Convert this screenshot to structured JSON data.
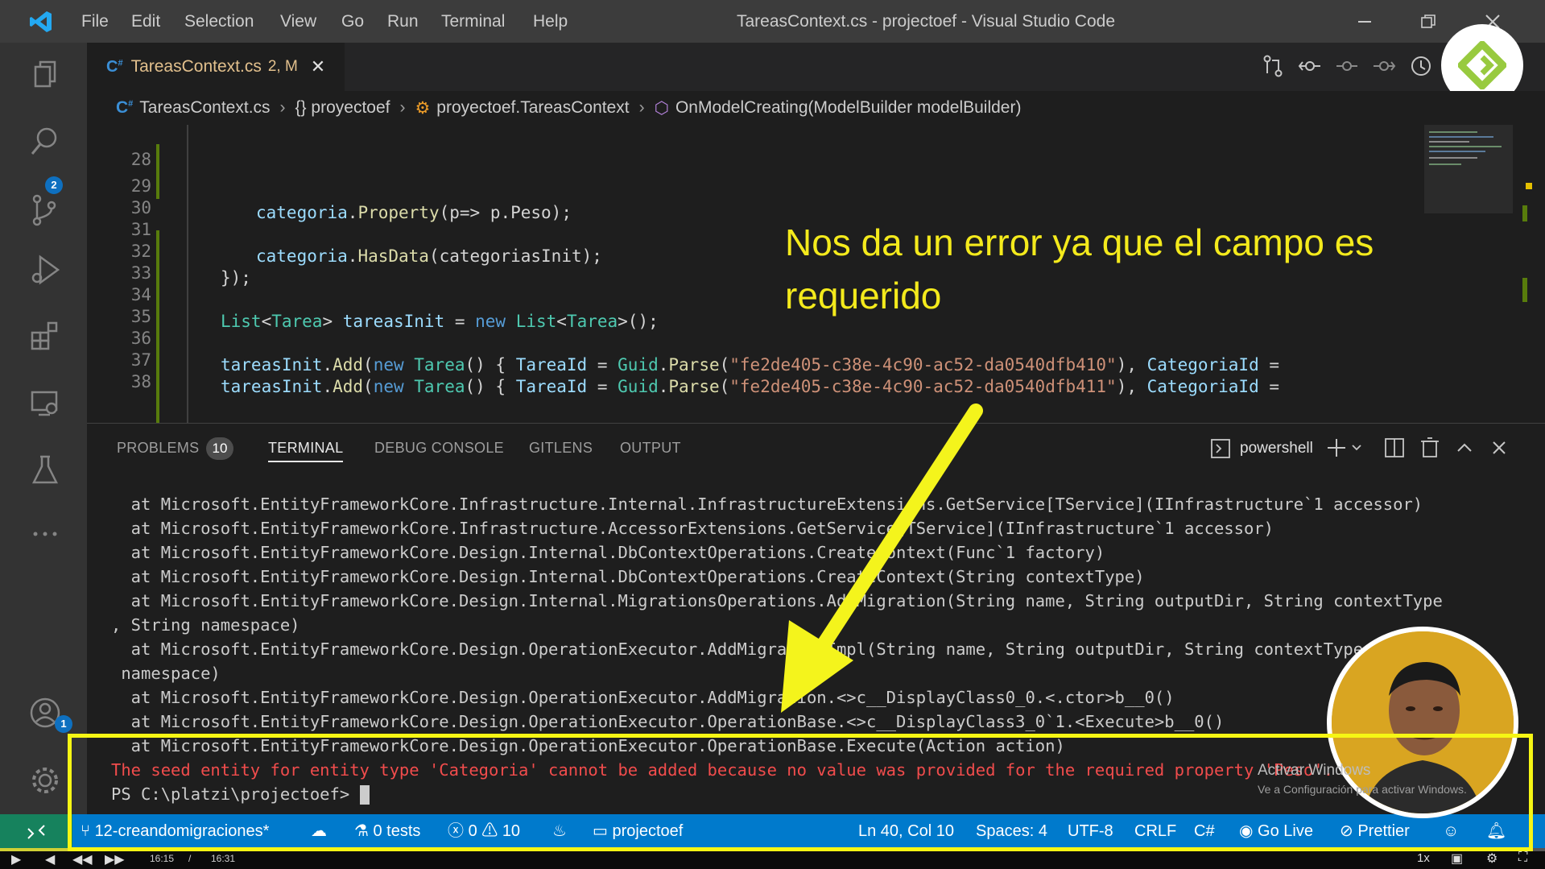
{
  "window": {
    "title": "TareasContext.cs - projectoef - Visual Studio Code",
    "menu": [
      "File",
      "Edit",
      "Selection",
      "View",
      "Go",
      "Run",
      "Terminal",
      "Help"
    ]
  },
  "activity_bar": {
    "source_control_badge": "2",
    "accounts_badge": "1",
    "icons": [
      "explorer-icon",
      "search-icon",
      "source-control-icon",
      "run-debug-icon",
      "extensions-icon",
      "remote-explorer-icon",
      "testing-icon",
      "more-icon",
      "accounts-icon",
      "manage-gear-icon"
    ]
  },
  "tab": {
    "label": "TareasContext.cs",
    "status": "2, M",
    "close": "✕"
  },
  "breadcrumb": {
    "file": "TareasContext.cs",
    "namespace": "{} proyectoef",
    "class": "proyectoef.TareasContext",
    "method": "OnModelCreating(ModelBuilder modelBuilder)"
  },
  "editor": {
    "line_numbers": [
      "28",
      "29",
      "30",
      "31",
      "32",
      "33",
      "34",
      "35",
      "36",
      "37",
      "38"
    ],
    "line29": {
      "obj": "categoria",
      "dot": ".",
      "fn": "Property",
      "args": "(p=> p.Peso);"
    },
    "line31": {
      "obj": "categoria",
      "dot": ".",
      "fn": "HasData",
      "args": "(categoriasInit);"
    },
    "line32": "});",
    "line34": {
      "t1": "List",
      "lt": "<",
      "t2": "Tarea",
      "gt": ">",
      "var": " tareasInit",
      "eq": " = ",
      "kw": "new",
      "t3": " List",
      "lt2": "<",
      "t4": "Tarea",
      "end": ">();"
    },
    "line36": {
      "var": "tareasInit",
      "dot": ".",
      "fn": "Add",
      "p1": "(",
      "kw": "new",
      "t": " Tarea",
      "p2": "() { ",
      "prop": "TareaId",
      "eq": " = ",
      "cls": "Guid",
      "dot2": ".",
      "fn2": "Parse",
      "p3": "(",
      "str": "\"fe2de405-c38e-4c90-ac52-da0540dfb410\"",
      "p4": "), ",
      "prop2": "CategoriaId",
      "eq2": " ="
    },
    "line37": {
      "var": "tareasInit",
      "dot": ".",
      "fn": "Add",
      "p1": "(",
      "kw": "new",
      "t": " Tarea",
      "p2": "() { ",
      "prop": "TareaId",
      "eq": " = ",
      "cls": "Guid",
      "dot2": ".",
      "fn2": "Parse",
      "p3": "(",
      "str": "\"fe2de405-c38e-4c90-ac52-da0540dfb411\"",
      "p4": "), ",
      "prop2": "CategoriaId",
      "eq2": " ="
    }
  },
  "annotation": {
    "line1": "Nos da un error ya que el campo es",
    "line2": "requerido"
  },
  "panel": {
    "tabs": {
      "problems": "PROBLEMS",
      "problems_count": "10",
      "terminal": "TERMINAL",
      "debug_console": "DEBUG CONSOLE",
      "gitlens": "GITLENS",
      "output": "OUTPUT"
    },
    "shell": "powershell"
  },
  "terminal": {
    "lines": [
      "  at Microsoft.EntityFrameworkCore.Infrastructure.Internal.InfrastructureExtensions.GetService[TService](IInfrastructure`1 accessor)",
      "  at Microsoft.EntityFrameworkCore.Infrastructure.AccessorExtensions.GetService[TService](IInfrastructure`1 accessor)",
      "  at Microsoft.EntityFrameworkCore.Design.Internal.DbContextOperations.CreateContext(Func`1 factory)",
      "  at Microsoft.EntityFrameworkCore.Design.Internal.DbContextOperations.CreateContext(String contextType)",
      "  at Microsoft.EntityFrameworkCore.Design.Internal.MigrationsOperations.AddMigration(String name, String outputDir, String contextType",
      ", String namespace)",
      "  at Microsoft.EntityFrameworkCore.Design.OperationExecutor.AddMigrationImpl(String name, String outputDir, String contextType, String",
      " namespace)",
      "  at Microsoft.EntityFrameworkCore.Design.OperationExecutor.AddMigration.<>c__DisplayClass0_0.<.ctor>b__0()",
      "  at Microsoft.EntityFrameworkCore.Design.OperationExecutor.OperationBase.<>c__DisplayClass3_0`1.<Execute>b__0()",
      "  at Microsoft.EntityFrameworkCore.Design.OperationExecutor.OperationBase.Execute(Action action)"
    ],
    "error": "The seed entity for entity type 'Categoria' cannot be added because no value was provided for the required property 'Peso'.",
    "prompt": "PS C:\\platzi\\projectoef> "
  },
  "statusbar": {
    "branch": "12-creandomigraciones*",
    "tests": "0 tests",
    "errors": "0",
    "warnings": "10",
    "folder": "projectoef",
    "position": "Ln 40, Col 10",
    "spaces": "Spaces: 4",
    "encoding": "UTF-8",
    "eol": "CRLF",
    "language": "C#",
    "golive": "Go Live",
    "prettier": "Prettier"
  },
  "watermark": {
    "title": "Activar Windows",
    "subtitle": "Ve a Configuración para activar Windows."
  },
  "video": {
    "time_current": "16:15",
    "time_total": "16:31",
    "speed": "1x"
  },
  "colors": {
    "accent": "#007acc",
    "annotation": "#f4ea1c",
    "error": "#f14c4c"
  }
}
